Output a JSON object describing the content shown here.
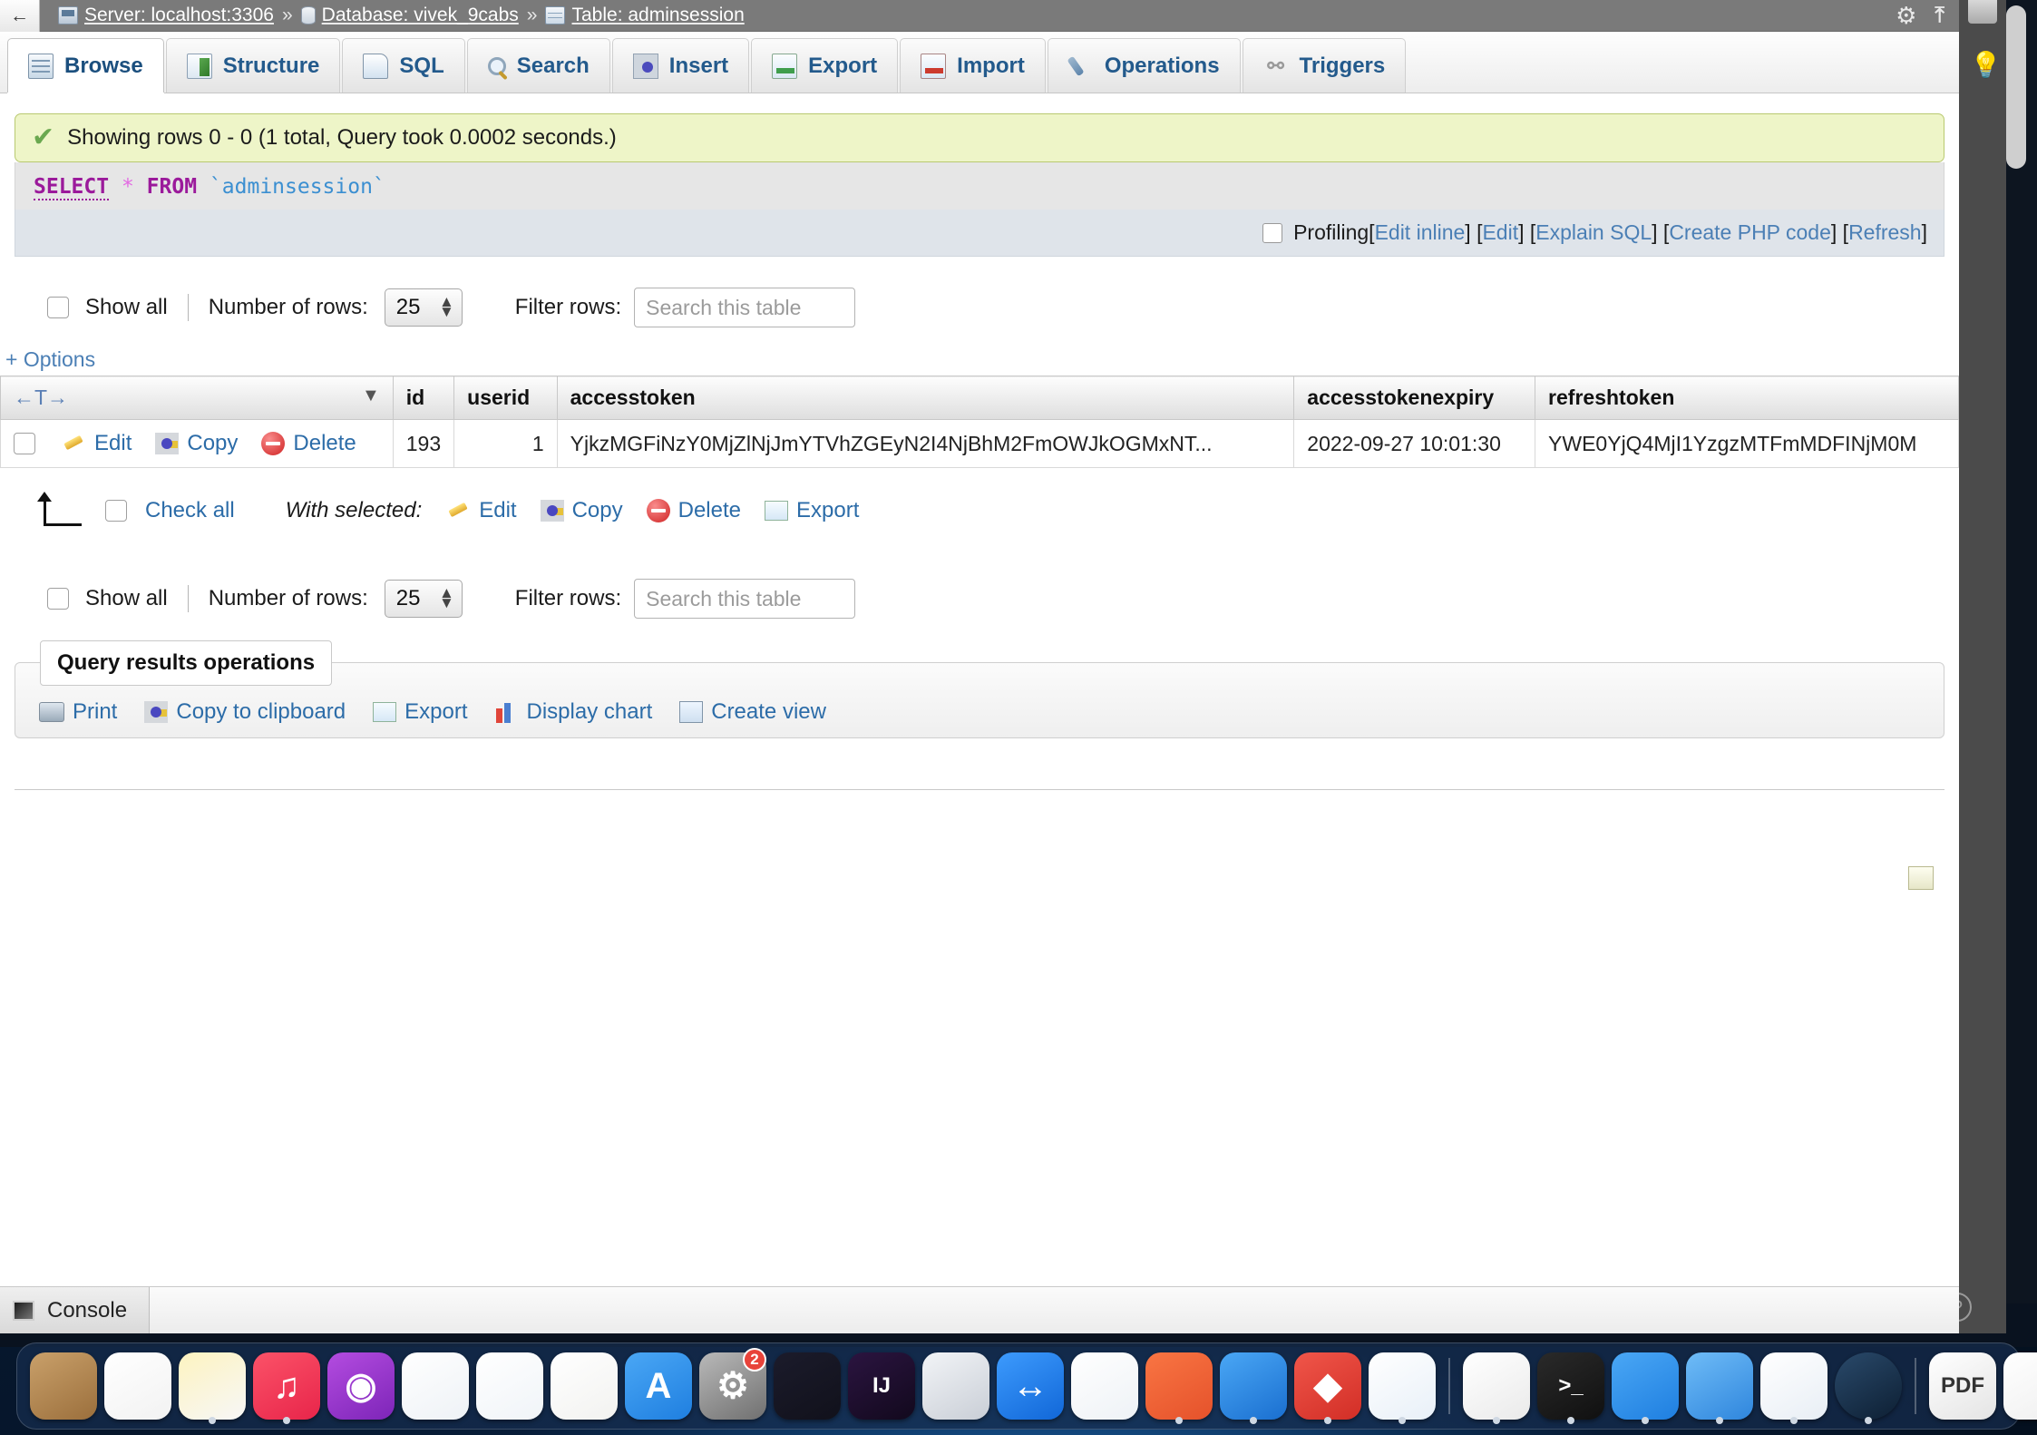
{
  "breadcrumb": {
    "back_label": "←",
    "items": [
      {
        "icon": "server-icon",
        "label": "Server: localhost:3306"
      },
      {
        "icon": "database-icon",
        "label": "Database: vivek_9cabs"
      },
      {
        "icon": "table-icon",
        "label": "Table: adminsession"
      }
    ],
    "separator": "»",
    "settings_icon": "gear-icon",
    "collapse_icon": "collapse-up-icon"
  },
  "tabs": [
    {
      "label": "Browse",
      "icon": "browse-icon",
      "active": true
    },
    {
      "label": "Structure",
      "icon": "structure-icon",
      "active": false
    },
    {
      "label": "SQL",
      "icon": "sql-icon",
      "active": false
    },
    {
      "label": "Search",
      "icon": "search-icon",
      "active": false
    },
    {
      "label": "Insert",
      "icon": "insert-icon",
      "active": false
    },
    {
      "label": "Export",
      "icon": "export-icon",
      "active": false
    },
    {
      "label": "Import",
      "icon": "import-icon",
      "active": false
    },
    {
      "label": "Operations",
      "icon": "wrench-icon",
      "active": false
    },
    {
      "label": "Triggers",
      "icon": "triggers-icon",
      "active": false
    }
  ],
  "success": {
    "icon": "green-check-icon",
    "message": "Showing rows 0 - 0 (1 total, Query took 0.0002 seconds.)"
  },
  "sql": {
    "keyword1": "SELECT",
    "star": "*",
    "keyword2": "FROM",
    "backtick_open": "`",
    "identifier": "adminsession",
    "backtick_close": "`"
  },
  "sql_actions": {
    "profiling_label": "Profiling",
    "open_bracket": "[",
    "edit_inline": "Edit inline",
    "sep1": "] [",
    "edit": "Edit",
    "sep2": "] [",
    "explain_sql": "Explain SQL",
    "sep3": "] [",
    "create_php": "Create PHP code",
    "sep4": "] [",
    "refresh": "Refresh",
    "close_bracket": "]"
  },
  "rows_controls": {
    "show_all_label": "Show all",
    "number_of_rows_label": "Number of rows:",
    "number_of_rows_value": "25",
    "filter_rows_label": "Filter rows:",
    "filter_placeholder": "Search this table"
  },
  "options_link": "+ Options",
  "table": {
    "sort_icon_label": "←T→",
    "dropdown_icon": "chevron-down-icon",
    "columns": [
      "id",
      "userid",
      "accesstoken",
      "accesstokenexpiry",
      "refreshtoken"
    ],
    "rows": [
      {
        "edit_label": "Edit",
        "copy_label": "Copy",
        "delete_label": "Delete",
        "id": "193",
        "userid": "1",
        "accesstoken": "YjkzMGFiNzY0MjZlNjJmYTVhZGEyN2I4NjBhM2FmOWJkOGMxNT...",
        "accesstokenexpiry": "2022-09-27 10:01:30",
        "refreshtoken": "YWE0YjQ4MjI1YzgzMTFmMDFINjM0M"
      }
    ]
  },
  "with_selected": {
    "check_all_label": "Check all",
    "label": "With selected:",
    "edit": "Edit",
    "copy": "Copy",
    "delete": "Delete",
    "export": "Export"
  },
  "query_results_operations": {
    "legend": "Query results operations",
    "actions": [
      {
        "label": "Print",
        "icon": "printer-icon"
      },
      {
        "label": "Copy to clipboard",
        "icon": "clipboard-icon"
      },
      {
        "label": "Export",
        "icon": "export-icon"
      },
      {
        "label": "Display chart",
        "icon": "bar-chart-icon"
      },
      {
        "label": "Create view",
        "icon": "create-view-icon"
      }
    ]
  },
  "console": {
    "label": "Console",
    "icon": "console-icon"
  },
  "right_rail": {
    "bulb_icon": "lightbulb-icon",
    "help_label": "?"
  },
  "dock": {
    "items": [
      {
        "name": "finder",
        "color1": "#c9a06a",
        "color2": "#9b6f3c",
        "shape": "rounded",
        "glyph": "",
        "running": false
      },
      {
        "name": "reminders",
        "color1": "#ffffff",
        "color2": "#f2f2f2",
        "shape": "rounded",
        "glyph": "",
        "running": false
      },
      {
        "name": "notes",
        "color1": "#fdf3c0",
        "color2": "#f7f7f7",
        "shape": "rounded",
        "glyph": "",
        "running": true
      },
      {
        "name": "music",
        "color1": "#fb5268",
        "color2": "#e8254a",
        "shape": "rounded",
        "glyph": "♫",
        "running": true
      },
      {
        "name": "podcasts",
        "color1": "#b44ce0",
        "color2": "#7d25b8",
        "shape": "rounded",
        "glyph": "◉",
        "running": false
      },
      {
        "name": "keynote",
        "color1": "#ffffff",
        "color2": "#eef2f6",
        "shape": "rounded",
        "glyph": "",
        "running": false
      },
      {
        "name": "numbers",
        "color1": "#ffffff",
        "color2": "#f0f4f8",
        "shape": "rounded",
        "glyph": "",
        "running": false
      },
      {
        "name": "pages",
        "color1": "#ffffff",
        "color2": "#f2f2f0",
        "shape": "rounded",
        "glyph": "",
        "running": false
      },
      {
        "name": "app-store",
        "color1": "#4aa7f5",
        "color2": "#1f7fe0",
        "shape": "rounded",
        "glyph": "A",
        "running": false
      },
      {
        "name": "system-settings",
        "color1": "#b9b9b9",
        "color2": "#707070",
        "shape": "rounded",
        "glyph": "⚙",
        "running": false,
        "badge": "2"
      },
      {
        "name": "blender",
        "color1": "#1b1b2b",
        "color2": "#11111b",
        "shape": "rounded",
        "glyph": "",
        "running": false
      },
      {
        "name": "intellij-idea",
        "color1": "#2b1440",
        "color2": "#12091d",
        "shape": "rounded",
        "glyph": "IJ",
        "running": false
      },
      {
        "name": "xcode-instruments",
        "color1": "#f2f4f7",
        "color2": "#c9ced6",
        "shape": "rounded",
        "glyph": "",
        "running": false
      },
      {
        "name": "teamviewer",
        "color1": "#3d9bfd",
        "color2": "#1167d8",
        "shape": "rounded",
        "glyph": "↔",
        "running": false
      },
      {
        "name": "android-studio",
        "color1": "#ffffff",
        "color2": "#eef2f6",
        "shape": "rounded",
        "glyph": "",
        "running": false
      },
      {
        "name": "sketch",
        "color1": "#f97543",
        "color2": "#e5522b",
        "shape": "rounded",
        "glyph": "",
        "running": true
      },
      {
        "name": "xcode",
        "color1": "#4aa7f5",
        "color2": "#1a6fd0",
        "shape": "rounded",
        "glyph": "",
        "running": true
      },
      {
        "name": "affinity",
        "color1": "#f0564a",
        "color2": "#d22e26",
        "shape": "rounded",
        "glyph": "◆",
        "running": true
      },
      {
        "name": "sourcetree",
        "color1": "#ffffff",
        "color2": "#e8f0f8",
        "shape": "rounded",
        "glyph": "",
        "running": true
      },
      {
        "name": "google-chrome",
        "color1": "#ffffff",
        "color2": "#eaeaea",
        "shape": "rounded",
        "glyph": "",
        "running": true
      },
      {
        "name": "terminal",
        "color1": "#2a2a2a",
        "color2": "#101010",
        "shape": "rounded",
        "glyph": ">_",
        "running": true
      },
      {
        "name": "utilities",
        "color1": "#4aa7f5",
        "color2": "#1f7fe0",
        "shape": "rounded",
        "glyph": "",
        "running": true
      },
      {
        "name": "simulator",
        "color1": "#6fbcf7",
        "color2": "#2f86dd",
        "shape": "rounded",
        "glyph": "",
        "running": true
      },
      {
        "name": "vs-code",
        "color1": "#ffffff",
        "color2": "#e8eef5",
        "shape": "rounded",
        "glyph": "",
        "running": true
      },
      {
        "name": "steam",
        "color1": "#2a4a6b",
        "color2": "#0d1f33",
        "shape": "round",
        "glyph": "",
        "running": true
      },
      {
        "name": "pdf-document",
        "color1": "#ffffff",
        "color2": "#e4e4e4",
        "shape": "rounded",
        "glyph": "PDF",
        "running": false
      },
      {
        "name": "screenshot-mobile",
        "color1": "#ffffff",
        "color2": "#efefef",
        "shape": "rounded",
        "glyph": "",
        "running": false
      },
      {
        "name": "screenshot-code",
        "color1": "#20242c",
        "color2": "#12151b",
        "shape": "rounded",
        "glyph": "",
        "running": false
      },
      {
        "name": "trash",
        "color1": "#cfd4da",
        "color2": "#8d949c",
        "shape": "rounded",
        "glyph": "",
        "running": false
      }
    ],
    "separator_after_indexes": [
      24,
      19
    ]
  }
}
